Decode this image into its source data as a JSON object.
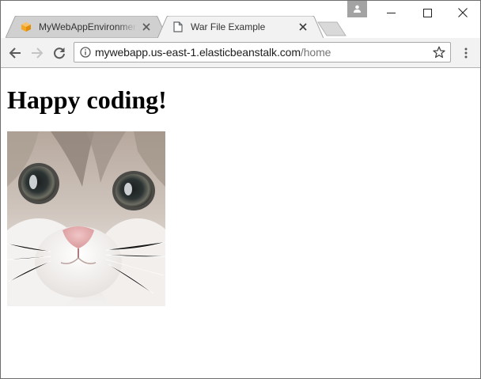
{
  "tabs": [
    {
      "title": "MyWebAppEnvironment",
      "favicon": "aws-cube-icon",
      "active": false
    },
    {
      "title": "War File Example",
      "favicon": "page-icon",
      "active": true
    }
  ],
  "address_bar": {
    "url_host": "mywebapp.us-east-1.elasticbeanstalk.com",
    "url_path": "/home"
  },
  "page": {
    "heading": "Happy coding!",
    "image": "kitten-photo"
  },
  "colors": {
    "toolbar_bg": "#f2f2f2",
    "inactive_tab_bg": "#d0d0d0",
    "active_tab_bg": "#f2f2f2",
    "favicon_orange": "#f5a623",
    "url_path_gray": "#757575"
  }
}
